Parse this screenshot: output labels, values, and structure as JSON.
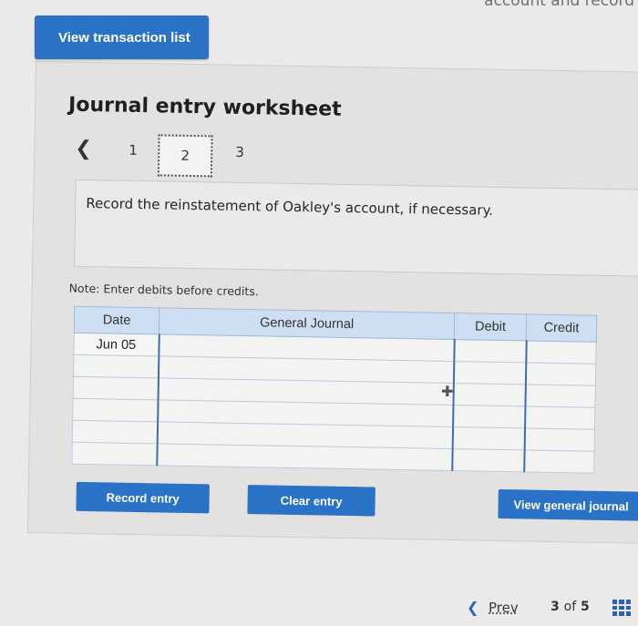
{
  "header": {
    "cut_text": "account and record",
    "view_transactions_label": "View transaction list"
  },
  "worksheet": {
    "title": "Journal entry worksheet",
    "steps": [
      "1",
      "2",
      "3"
    ],
    "active_step": "2",
    "instruction": "Record the reinstatement of Oakley's account, if necessary.",
    "note": "Note: Enter debits before credits."
  },
  "journal": {
    "headers": {
      "date": "Date",
      "general_journal": "General Journal",
      "debit": "Debit",
      "credit": "Credit"
    },
    "rows": [
      {
        "date": "Jun 05",
        "account": "",
        "debit": "",
        "credit": ""
      },
      {
        "date": "",
        "account": "",
        "debit": "",
        "credit": ""
      },
      {
        "date": "",
        "account": "",
        "debit": "",
        "credit": ""
      },
      {
        "date": "",
        "account": "",
        "debit": "",
        "credit": ""
      },
      {
        "date": "",
        "account": "",
        "debit": "",
        "credit": ""
      },
      {
        "date": "",
        "account": "",
        "debit": "",
        "credit": ""
      }
    ]
  },
  "actions": {
    "record_entry": "Record entry",
    "clear_entry": "Clear entry",
    "view_general_journal": "View general journal"
  },
  "footer": {
    "prev_label": "Prev",
    "page_current": "3",
    "page_of": "of",
    "page_total": "5"
  },
  "colors": {
    "accent": "#2a72c6",
    "table_header": "#cfdff3"
  },
  "icons": {
    "back": "chevron-left-icon",
    "cursor": "move-cursor-icon",
    "grid": "grid-icon"
  }
}
